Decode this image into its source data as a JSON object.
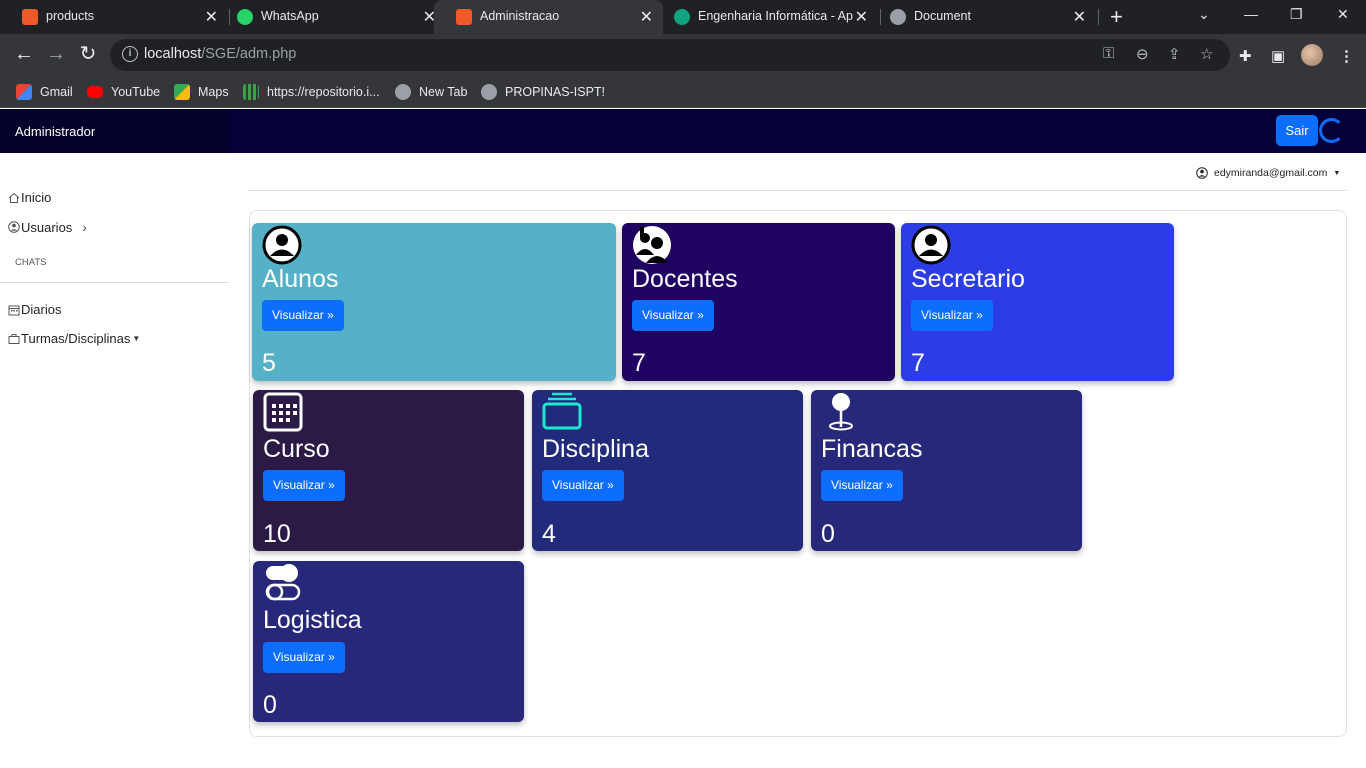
{
  "browser": {
    "tabs": [
      {
        "title": "products",
        "close": "✕",
        "favicon_color": "#f05a28"
      },
      {
        "title": "WhatsApp",
        "close": "✕",
        "favicon_color": "#25d366"
      },
      {
        "title": "Administracao",
        "close": "✕",
        "favicon_color": "#f05a28"
      },
      {
        "title": "Engenharia Informática - Apa",
        "close": "✕",
        "favicon_color": "#10a37f"
      },
      {
        "title": "Document",
        "close": "✕",
        "favicon_color": "#9aa0a6"
      }
    ],
    "url_host": "localhost",
    "url_path": "/SGE/adm.php",
    "bookmarks": [
      {
        "label": "Gmail",
        "icon": "gmail-icon"
      },
      {
        "label": "YouTube",
        "icon": "youtube-icon"
      },
      {
        "label": "Maps",
        "icon": "maps-icon"
      },
      {
        "label": "https://repositorio.i...",
        "icon": "repo-icon"
      },
      {
        "label": "New Tab",
        "icon": "globe-icon"
      },
      {
        "label": "PROPINAS-ISPT!",
        "icon": "globe-icon"
      }
    ]
  },
  "app": {
    "brand": "Administrador",
    "logout_label": "Sair",
    "user_email": "edymiranda@gmail.com",
    "sidebar": {
      "items": [
        {
          "label": "Inicio",
          "icon": "home-icon"
        },
        {
          "label": "Usuarios",
          "icon": "user-circle-icon"
        }
      ],
      "heading": "CHATS",
      "items2": [
        {
          "label": "Diarios",
          "icon": "calendar-icon"
        },
        {
          "label": "Turmas/Disciplinas",
          "icon": "briefcase-icon"
        }
      ]
    },
    "cards": [
      {
        "title": "Alunos",
        "button": "Visualizar »",
        "count": "5",
        "color": "#55b1c8",
        "icon": "person-circle-icon"
      },
      {
        "title": "Docentes",
        "button": "Visualizar »",
        "count": "7",
        "color": "#1f0361",
        "icon": "people-icon"
      },
      {
        "title": "Secretario",
        "button": "Visualizar »",
        "count": "7",
        "color": "#2c3de6",
        "icon": "person-circle-icon"
      },
      {
        "title": "Curso",
        "button": "Visualizar »",
        "count": "10",
        "color": "#2a1a45",
        "icon": "calendar-grid-icon"
      },
      {
        "title": "Disciplina",
        "button": "Visualizar »",
        "count": "4",
        "color": "#222a7c",
        "icon": "collection-icon"
      },
      {
        "title": "Financas",
        "button": "Visualizar »",
        "count": "0",
        "color": "#28287a",
        "icon": "pin-icon"
      },
      {
        "title": "Logistica",
        "button": "Visualizar »",
        "count": "0",
        "color": "#28287a",
        "icon": "toggles-icon"
      }
    ]
  }
}
